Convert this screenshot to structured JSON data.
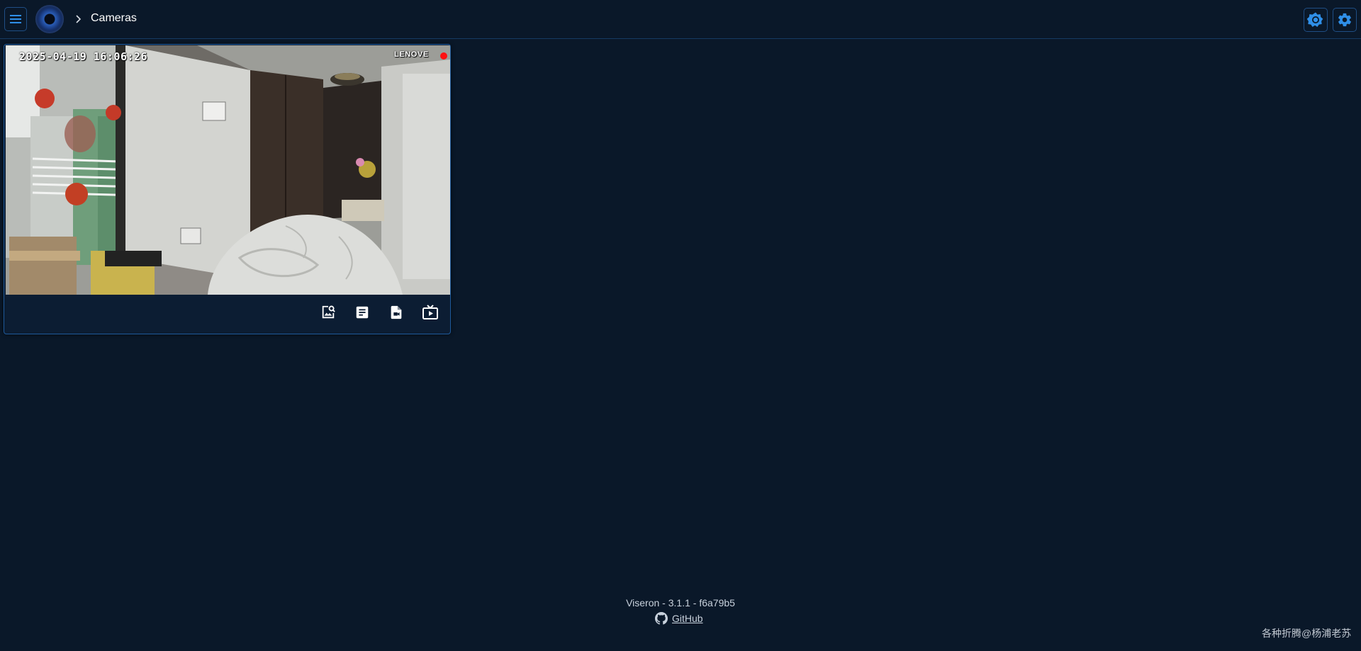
{
  "header": {
    "breadcrumb_title": "Cameras",
    "menu_icon": "menu-icon",
    "logo": "viseron-logo",
    "theme_icon": "brightness-icon",
    "settings_icon": "gear-icon",
    "accent_color": "#1e88e5"
  },
  "camera_card": {
    "timestamp": "2025-04-19  16:06:26",
    "camera_label": "LENOVE",
    "recording_indicator_color": "#ff1010",
    "actions": [
      {
        "name": "snapshot-search",
        "icon": "image-search-icon"
      },
      {
        "name": "events",
        "icon": "event-list-icon"
      },
      {
        "name": "recordings",
        "icon": "video-file-icon"
      },
      {
        "name": "live-view",
        "icon": "live-tv-icon"
      }
    ]
  },
  "footer": {
    "version": "Viseron - 3.1.1 - f6a79b5",
    "github_label": "GitHub",
    "github_icon": "github-icon"
  },
  "watermark": "各种折腾@杨浦老苏"
}
